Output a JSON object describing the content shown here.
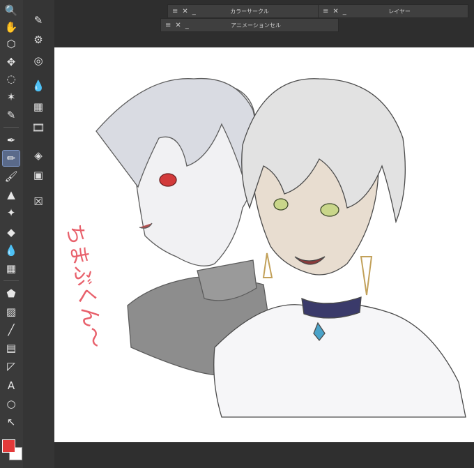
{
  "panels": {
    "color_circle": "カラーサークル",
    "layer": "レイヤー",
    "animation_cel": "アニメーションセル"
  },
  "panel_controls": {
    "menu": "≡",
    "close": "✕",
    "minimize": "_"
  },
  "tools": [
    {
      "name": "zoom-icon",
      "glyph": "🔍"
    },
    {
      "name": "hand-icon",
      "glyph": "✋"
    },
    {
      "name": "operation-icon",
      "glyph": "⬡"
    },
    {
      "name": "move-icon",
      "glyph": "✥"
    },
    {
      "name": "lasso-select-icon",
      "glyph": "◌"
    },
    {
      "name": "auto-select-icon",
      "glyph": "✶"
    },
    {
      "name": "eyedropper-icon",
      "glyph": "✎"
    },
    {
      "name": "pen-icon",
      "glyph": "✒"
    },
    {
      "name": "pencil-icon",
      "glyph": "✏"
    },
    {
      "name": "brush-icon",
      "glyph": "🖌"
    },
    {
      "name": "airbrush-icon",
      "glyph": "▲"
    },
    {
      "name": "decoration-icon",
      "glyph": "✦"
    },
    {
      "name": "eraser-icon",
      "glyph": "◆"
    },
    {
      "name": "blend-icon",
      "glyph": "💧"
    },
    {
      "name": "grid-icon",
      "glyph": "▦"
    },
    {
      "name": "fill-icon",
      "glyph": "⬟"
    },
    {
      "name": "gradient-icon",
      "glyph": "▨"
    },
    {
      "name": "line-icon",
      "glyph": "╱"
    },
    {
      "name": "frame-icon",
      "glyph": "▤"
    },
    {
      "name": "ruler-icon",
      "glyph": "◸"
    },
    {
      "name": "text-icon",
      "glyph": "A"
    },
    {
      "name": "balloon-icon",
      "glyph": "○"
    },
    {
      "name": "correct-line-icon",
      "glyph": "↖"
    }
  ],
  "subtools": [
    {
      "name": "pen-subtool-icon",
      "glyph": "✎"
    },
    {
      "name": "settings-subtool-icon",
      "glyph": "⚙"
    },
    {
      "name": "target-subtool-icon",
      "glyph": "◎"
    },
    {
      "name": "drops-subtool-icon",
      "glyph": "💧"
    },
    {
      "name": "material-subtool-icon",
      "glyph": "▦"
    },
    {
      "name": "film-subtool-icon",
      "glyph": "🎞"
    },
    {
      "name": "layers-subtool-icon",
      "glyph": "◈"
    },
    {
      "name": "panel-subtool-icon",
      "glyph": "▣"
    },
    {
      "name": "close-box-subtool-icon",
      "glyph": "☒"
    }
  ],
  "colors": {
    "main": "#e43a3a",
    "sub": "#ffffff"
  },
  "handwriting": "ちまぶくん〜"
}
